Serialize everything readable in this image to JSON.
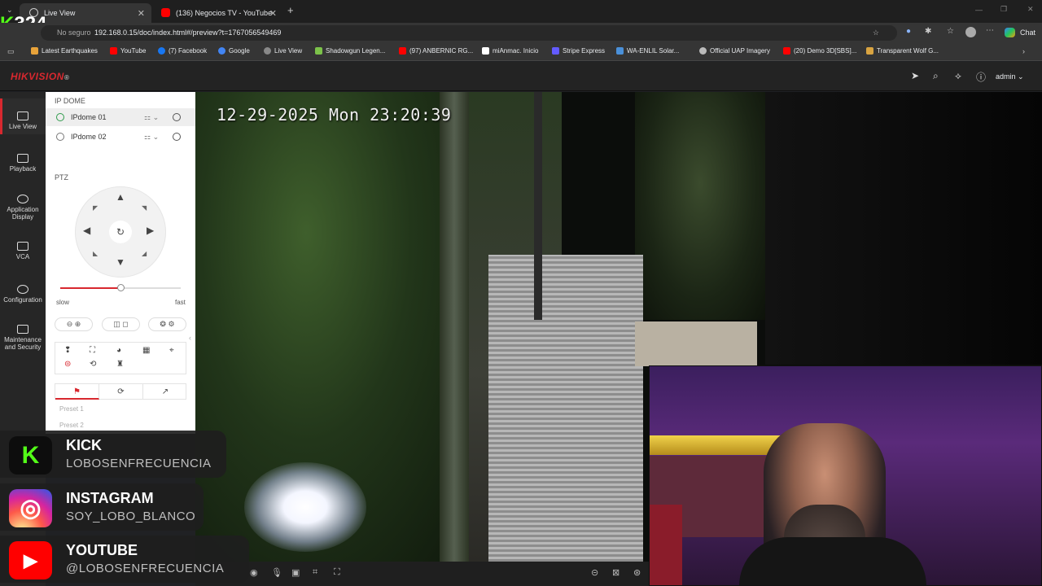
{
  "browser": {
    "tabs": [
      {
        "title": "Live View",
        "active": true
      },
      {
        "title": "(136) Negocios TV - YouTube",
        "active": false
      }
    ],
    "security_label": "No seguro",
    "url": "192.168.0.15/doc/index.html#/preview?t=1767056549469",
    "chat_label": "Chat",
    "bookmarks": [
      {
        "label": "Latest Earthquakes",
        "color": "#e8a33a"
      },
      {
        "label": "YouTube",
        "color": "#ff0000"
      },
      {
        "label": "(7) Facebook",
        "color": "#1877f2"
      },
      {
        "label": "Google",
        "color": "#4285f4"
      },
      {
        "label": "Live View",
        "color": "#888888"
      },
      {
        "label": "Shadowgun Legen...",
        "color": "#7cc24a"
      },
      {
        "label": "(97) ANBERNIC RG...",
        "color": "#ff0000"
      },
      {
        "label": "miAnmac. Inicio",
        "color": "#ffffff"
      },
      {
        "label": "Stripe Express",
        "color": "#635bff"
      },
      {
        "label": "WA-ENLIL Solar...",
        "color": "#4a90d9"
      },
      {
        "label": "Official UAP Imagery",
        "color": "#bbbbbb"
      },
      {
        "label": "(20) Demo 3D[SBS]...",
        "color": "#ff0000"
      },
      {
        "label": "Transparent Wolf G...",
        "color": "#d9a441"
      }
    ]
  },
  "stream_badge": {
    "prefix": "K",
    "count": "324"
  },
  "header": {
    "brand": "HIKVISION",
    "brand_mark": "®",
    "user": "admin"
  },
  "nav": [
    {
      "label": "Live View",
      "active": true
    },
    {
      "label": "Playback",
      "active": false
    },
    {
      "label": "Application Display",
      "active": false
    },
    {
      "label": "VCA",
      "active": false
    },
    {
      "label": "Configuration",
      "active": false
    },
    {
      "label": "Maintenance and Security",
      "active": false
    }
  ],
  "camera_panel": {
    "section": "IP DOME",
    "cameras": [
      {
        "name": "IPdome 01",
        "selected": true
      },
      {
        "name": "IPdome 02",
        "selected": false
      }
    ],
    "ptz_label": "PTZ",
    "speed_slow": "slow",
    "speed_fast": "fast",
    "speed_level": 0.5,
    "presets": [
      "Preset 1",
      "Preset 2"
    ]
  },
  "video": {
    "osd_timestamp": "12-29-2025 Mon 23:20:39"
  },
  "social": [
    {
      "platform": "KICK",
      "handle": "LOBOSENFRECUENCIA",
      "color": "#53fc18",
      "glyph": "K"
    },
    {
      "platform": "INSTAGRAM",
      "handle": "SOY_LOBO_BLANCO",
      "color": "#d6249f",
      "glyph": "◎"
    },
    {
      "platform": "YOUTUBE",
      "handle": "@LOBOSENFRECUENCIA",
      "color": "#ff0000",
      "glyph": "▶"
    }
  ]
}
